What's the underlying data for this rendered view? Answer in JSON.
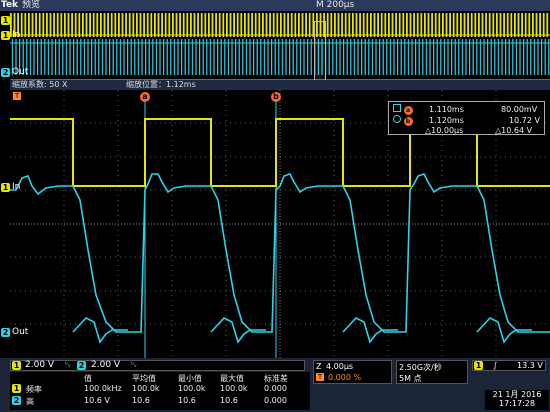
{
  "topbar": {
    "brand": "Tek",
    "mode": "预览",
    "timebase": "M 200µs"
  },
  "channels": {
    "ch1": {
      "num": "1",
      "label": "In",
      "color": "#e6e600"
    },
    "ch2": {
      "num": "2",
      "label": "Out",
      "color": "#2ad4ec"
    }
  },
  "zoom": {
    "factor": "缩放系数: 50 X",
    "position": "缩放位置：1.12ms"
  },
  "cursors": {
    "a_tag": "a",
    "b_tag": "b",
    "trigger_tag": "T"
  },
  "readout": {
    "a_time": "1.110ms",
    "a_volt": "80.00mV",
    "b_time": "1.120ms",
    "b_volt": "10.72 V",
    "dt": "△10.00µs",
    "dv": "△10.64 V",
    "a_badge": "a",
    "b_badge": "b"
  },
  "vscale": {
    "ch1": "2.00 V",
    "ch2": "2.00 V",
    "bw1": "ᵇᵥ",
    "bw2": "ᵇᵥ"
  },
  "measure": {
    "headers": [
      "值",
      "平均值",
      "最小值",
      "最大值",
      "标准差"
    ],
    "rows": [
      {
        "ch": "1",
        "name": "频率",
        "vals": [
          "100.0kHz",
          "100.0k",
          "100.0k",
          "100.0k",
          "0.000"
        ]
      },
      {
        "ch": "2",
        "name": "高",
        "vals": [
          "10.6 V",
          "10.6",
          "10.6",
          "10.6",
          "0.000"
        ]
      }
    ]
  },
  "horizontal": {
    "scale": "4.00µs",
    "position": "0.000 %"
  },
  "sample": {
    "rate": "2.50G次/秒",
    "points": "5M 点"
  },
  "trigger": {
    "ch": "1",
    "slope": "∫",
    "level": "13.3 V"
  },
  "datetime": {
    "date": "21 1月 2016",
    "time": "17:17:28"
  }
}
